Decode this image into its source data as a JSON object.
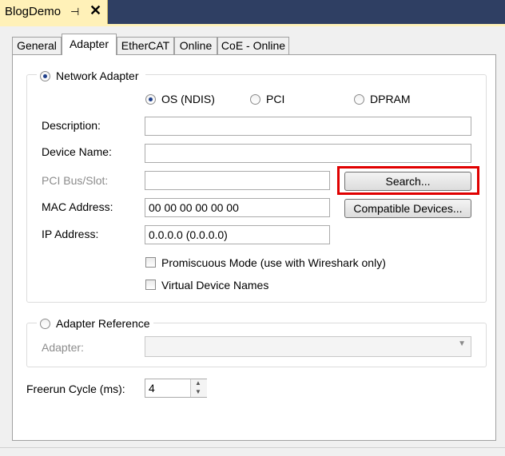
{
  "document_tab": {
    "title": "BlogDemo",
    "pin_icon": "pin-icon",
    "close_icon": "close-icon"
  },
  "tabs": [
    {
      "label": "General",
      "active": false
    },
    {
      "label": "Adapter",
      "active": true
    },
    {
      "label": "EtherCAT",
      "active": false
    },
    {
      "label": "Online",
      "active": false
    },
    {
      "label": "CoE - Online",
      "active": false
    }
  ],
  "network_adapter": {
    "label": "Network Adapter",
    "selected": true,
    "options": [
      {
        "label": "OS (NDIS)",
        "selected": true
      },
      {
        "label": "PCI",
        "selected": false
      },
      {
        "label": "DPRAM",
        "selected": false
      }
    ],
    "description": {
      "label": "Description:",
      "value": ""
    },
    "device_name": {
      "label": "Device Name:",
      "value": ""
    },
    "pci_bus_slot": {
      "label": "PCI Bus/Slot:",
      "value": "",
      "disabled": true
    },
    "search_button": "Search...",
    "mac_address": {
      "label": "MAC Address:",
      "value": "00 00 00 00 00 00"
    },
    "compatible_devices_button": "Compatible Devices...",
    "ip_address": {
      "label": "IP Address:",
      "value": "0.0.0.0 (0.0.0.0)"
    },
    "promiscuous_mode": {
      "label": "Promiscuous Mode (use with Wireshark only)",
      "checked": false
    },
    "virtual_device_names": {
      "label": "Virtual Device Names",
      "checked": false
    }
  },
  "adapter_reference": {
    "label": "Adapter Reference",
    "selected": false,
    "adapter": {
      "label": "Adapter:",
      "value": "",
      "disabled": true
    }
  },
  "freerun_cycle": {
    "label": "Freerun Cycle (ms):",
    "value": "4"
  },
  "colors": {
    "highlight": "#e00000",
    "doc_tab_bg": "#fff1b8",
    "titlebar_bg": "#2f3f63"
  }
}
